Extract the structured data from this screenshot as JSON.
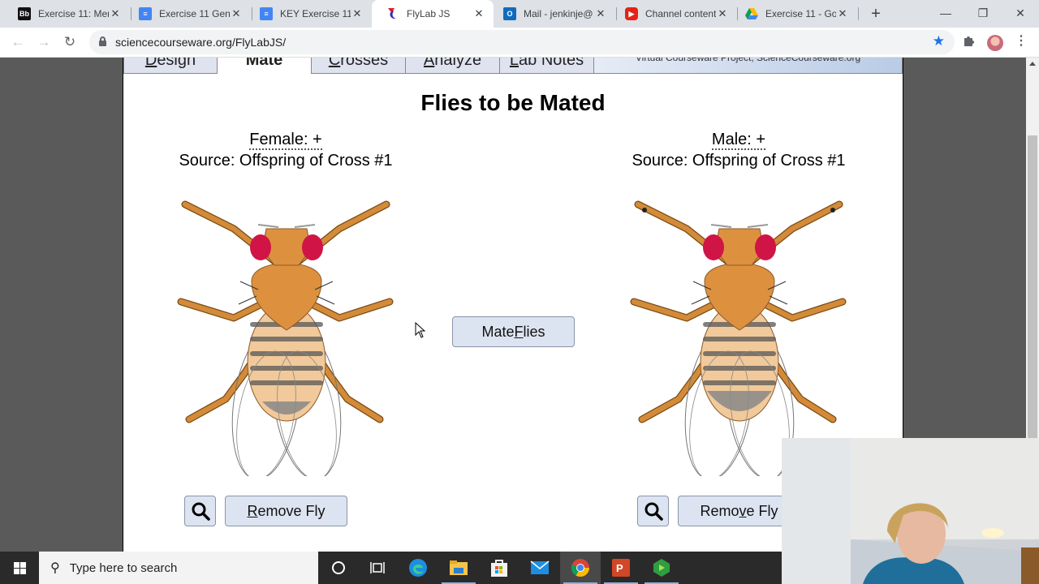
{
  "browser": {
    "tabs": [
      {
        "title": "Exercise 11: Men",
        "favicon": "blackboard-icon",
        "active": false
      },
      {
        "title": "Exercise 11 Gene",
        "favicon": "google-docs-icon",
        "active": false
      },
      {
        "title": "KEY Exercise 11",
        "favicon": "google-docs-icon",
        "active": false
      },
      {
        "title": "FlyLab JS",
        "favicon": "flylab-icon",
        "active": true
      },
      {
        "title": "Mail - jenkinje@",
        "favicon": "outlook-icon",
        "active": false
      },
      {
        "title": "Channel content",
        "favicon": "youtube-icon",
        "active": false
      },
      {
        "title": "Exercise 11 - Go",
        "favicon": "google-drive-icon",
        "active": false
      }
    ],
    "url": "sciencecourseware.org/FlyLabJS/",
    "bookmarked": true
  },
  "app": {
    "nav_tabs": [
      {
        "label": "Design",
        "accesskey": "D",
        "rest": "esign",
        "active": false
      },
      {
        "label": "Mate",
        "accesskey": "",
        "rest": "Mate",
        "active": true
      },
      {
        "label": "Crosses",
        "accesskey": "C",
        "rest": "rosses",
        "active": false
      },
      {
        "label": "Analyze",
        "accesskey": "A",
        "rest": "nalyze",
        "active": false
      },
      {
        "label": "Lab Notes",
        "accesskey": "L",
        "rest": "ab Notes",
        "active": false
      }
    ],
    "credit": "Virtual Courseware Project, ScienceCourseware.org",
    "title": "Flies to be Mated",
    "female": {
      "label": "Female: +",
      "source": "Source: Offspring of Cross #1",
      "remove_label_pre": "",
      "remove_label_key": "R",
      "remove_label_post": "emove Fly"
    },
    "male": {
      "label": "Male: +",
      "source": "Source: Offspring of Cross #1",
      "remove_label_pre": "Remo",
      "remove_label_key": "v",
      "remove_label_post": "e Fly"
    },
    "mate_button": {
      "pre": "Mate ",
      "key": "F",
      "post": "lies"
    }
  },
  "taskbar": {
    "search_placeholder": "Type here to search",
    "pinned": [
      "cortana-icon",
      "task-view-icon",
      "edge-icon",
      "file-explorer-icon",
      "store-icon",
      "mail-icon",
      "chrome-icon",
      "powerpoint-icon",
      "camtasia-icon"
    ],
    "active_app": "chrome-icon"
  }
}
